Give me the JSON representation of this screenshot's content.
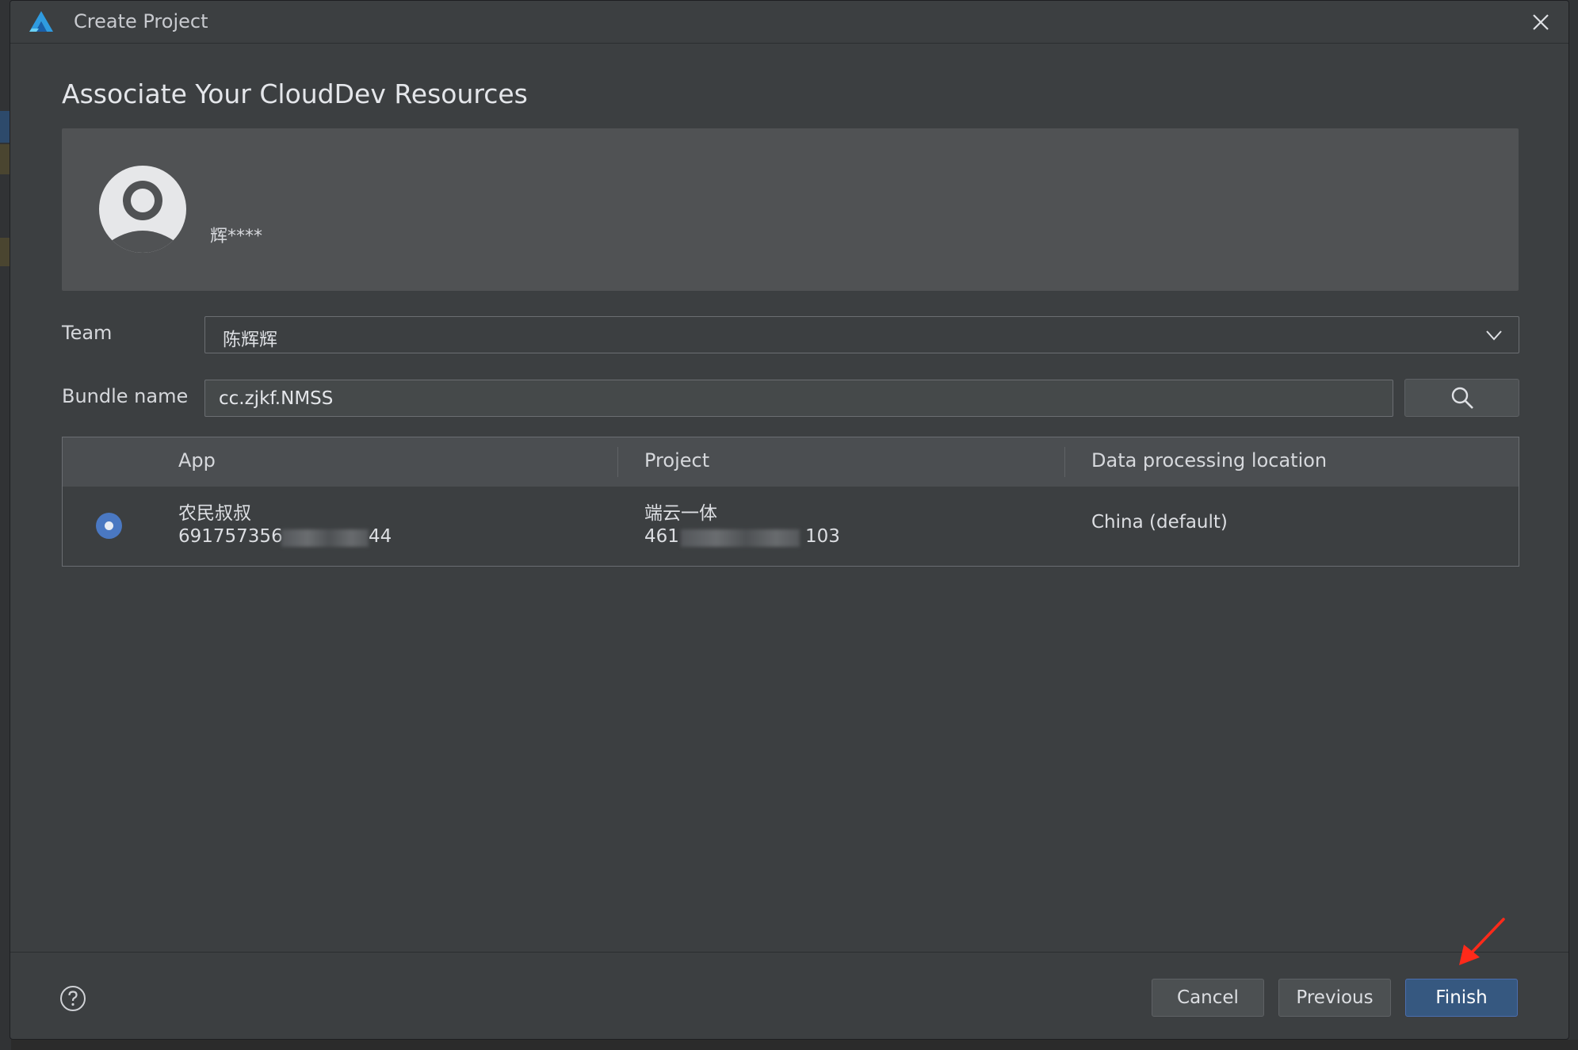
{
  "window": {
    "title": "Create Project",
    "logo_icon": "deveco-logo-icon",
    "close_icon": "close-icon"
  },
  "page": {
    "heading": "Associate Your CloudDev Resources"
  },
  "account": {
    "avatar_icon": "user-avatar-icon",
    "username": "辉****"
  },
  "form": {
    "team_label": "Team",
    "team_value": "陈辉辉",
    "bundle_label": "Bundle name",
    "bundle_value": "cc.zjkf.NMSS",
    "search_icon": "search-icon"
  },
  "table": {
    "columns": [
      "App",
      "Project",
      "Data processing location"
    ],
    "rows": [
      {
        "selected": true,
        "app_name": "农民叔叔",
        "app_id_prefix": "691757356",
        "app_id_suffix": "44",
        "project_name": "端云一体",
        "project_id_prefix": "461",
        "project_id_suffix": "103",
        "location": "China (default)"
      }
    ]
  },
  "footer": {
    "help_icon": "help-icon",
    "cancel_label": "Cancel",
    "previous_label": "Previous",
    "finish_label": "Finish"
  },
  "colors": {
    "dialog_bg": "#3c3f41",
    "card_bg": "#505254",
    "accent": "#365880",
    "radio": "#4a78c2",
    "annotation": "#ff2a1a"
  }
}
